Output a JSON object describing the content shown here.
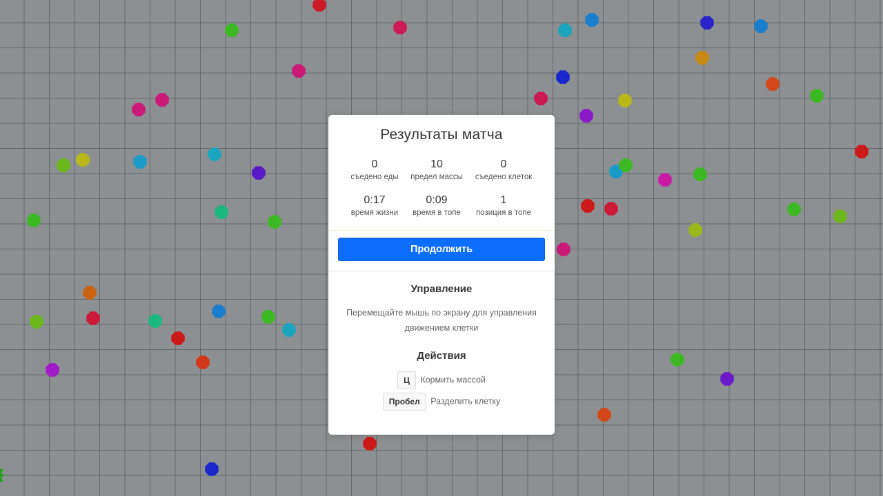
{
  "results": {
    "title": "Результаты матча",
    "stats": [
      {
        "value": "0",
        "label": "съедено еды"
      },
      {
        "value": "10",
        "label": "предел массы"
      },
      {
        "value": "0",
        "label": "съедено клеток"
      },
      {
        "value": "0:17",
        "label": "время жизни"
      },
      {
        "value": "0:09",
        "label": "время в топе"
      },
      {
        "value": "1",
        "label": "позиция в топе"
      }
    ],
    "continue_label": "Продолжить"
  },
  "controls": {
    "title": "Управление",
    "description": "Перемещайте мышь по экрану для управления движением клетки"
  },
  "actions": {
    "title": "Действия",
    "items": [
      {
        "key": "Ц",
        "description": "Кормить массой"
      },
      {
        "key": "Пробел",
        "description": "Разделить клетку"
      }
    ]
  },
  "colors": {
    "background": "#8d9092",
    "grid": "#5a5e62",
    "accent": "#0d6efd"
  }
}
